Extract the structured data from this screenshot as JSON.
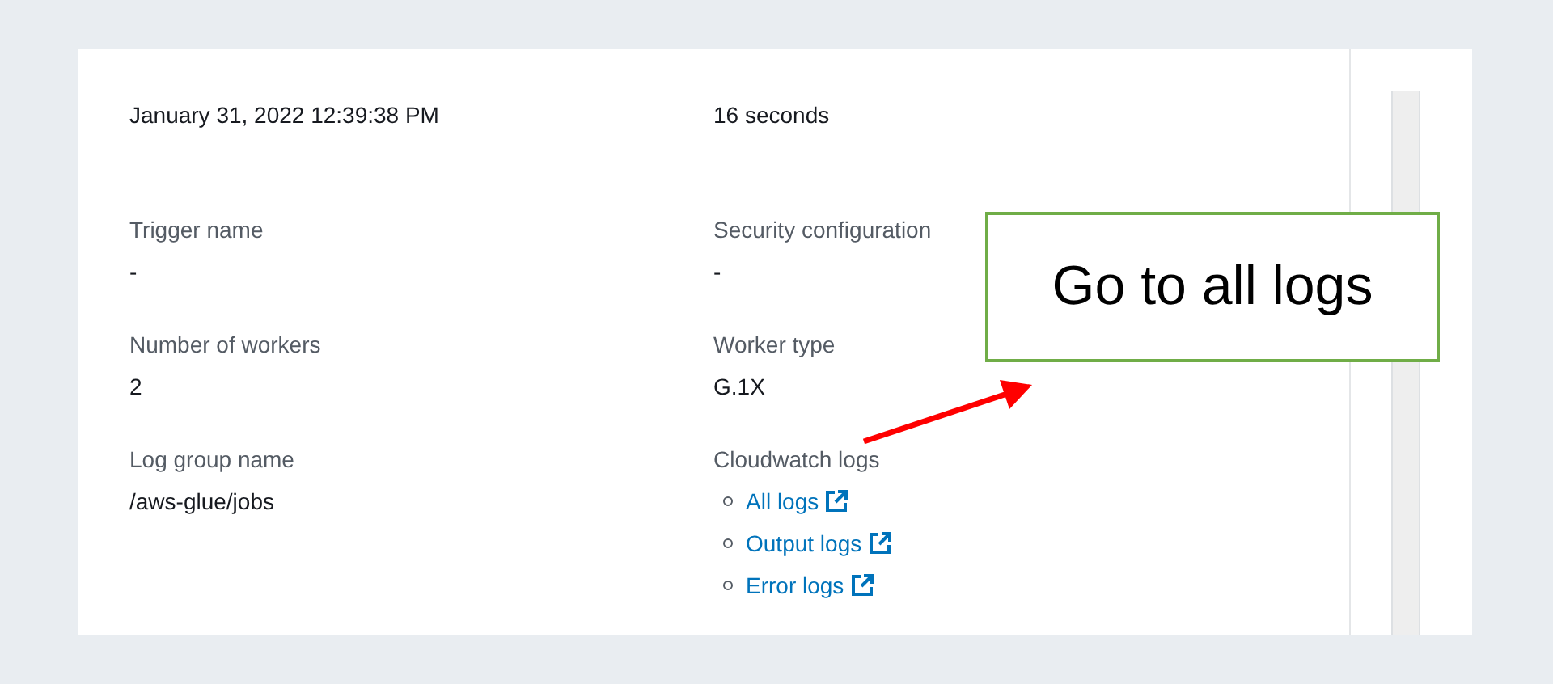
{
  "details": {
    "left": [
      {
        "value": "January 31, 2022 12:39:38 PM"
      },
      {
        "label": "Trigger name",
        "value": "-"
      },
      {
        "label": "Number of workers",
        "value": "2"
      },
      {
        "label": "Log group name",
        "value": "/aws-glue/jobs"
      }
    ],
    "right": [
      {
        "value": "16 seconds"
      },
      {
        "label": "Security configuration",
        "value": "-"
      },
      {
        "label": "Worker type",
        "value": "G.1X"
      },
      {
        "label": "Cloudwatch logs",
        "links": [
          "All logs",
          "Output logs",
          "Error logs"
        ]
      }
    ]
  },
  "callout": {
    "text": "Go to all logs"
  }
}
